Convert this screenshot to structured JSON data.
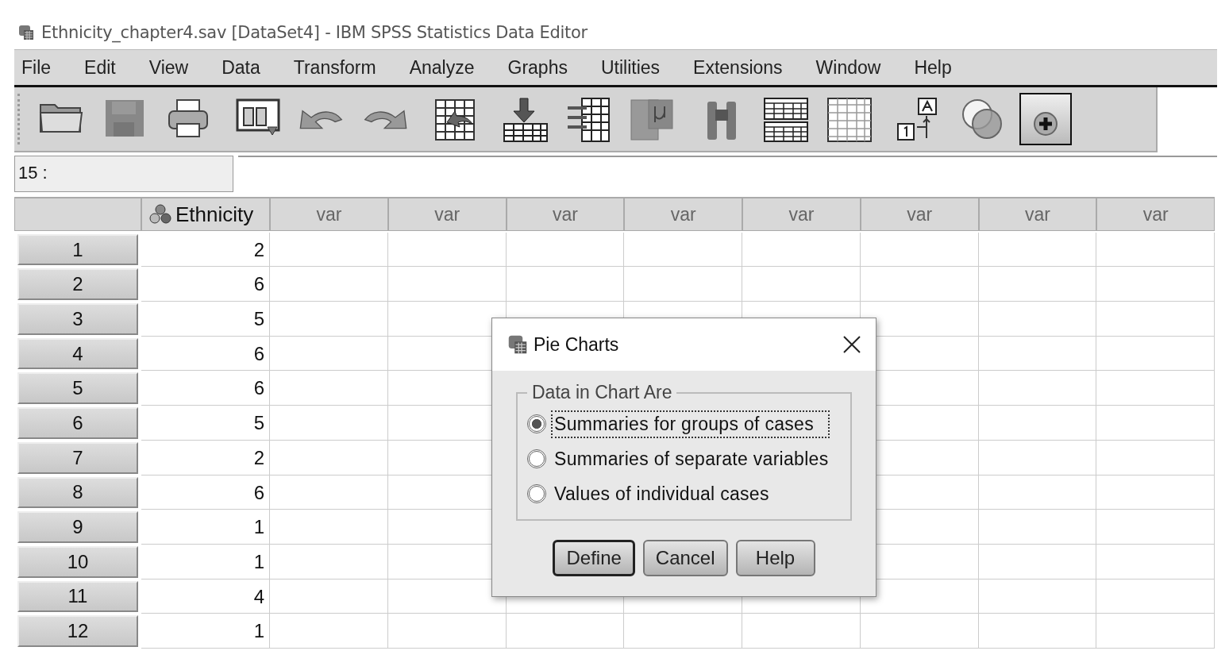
{
  "window": {
    "title": "Ethnicity_chapter4.sav [DataSet4] - IBM SPSS Statistics Data Editor"
  },
  "menu": [
    "File",
    "Edit",
    "View",
    "Data",
    "Transform",
    "Analyze",
    "Graphs",
    "Utilities",
    "Extensions",
    "Window",
    "Help"
  ],
  "toolbar": [
    {
      "kind": "open",
      "pressed": false
    },
    {
      "kind": "save",
      "pressed": false
    },
    {
      "kind": "print",
      "pressed": false
    },
    {
      "kind": "dialog",
      "pressed": false
    },
    {
      "kind": "undo",
      "pressed": false
    },
    {
      "kind": "redo",
      "pressed": false
    },
    {
      "kind": "goto",
      "pressed": false
    },
    {
      "kind": "insert",
      "pressed": false
    },
    {
      "kind": "variables",
      "pressed": false
    },
    {
      "kind": "stats",
      "pressed": false
    },
    {
      "kind": "find",
      "pressed": false
    },
    {
      "kind": "split",
      "pressed": false
    },
    {
      "kind": "grid",
      "pressed": false
    },
    {
      "kind": "labels",
      "pressed": false
    },
    {
      "kind": "sets",
      "pressed": false
    },
    {
      "kind": "plus",
      "pressed": true
    }
  ],
  "cell_ref": "15 :",
  "table": {
    "columns": [
      {
        "label": "Ethnicity",
        "kind": "variable"
      },
      {
        "label": "var",
        "kind": "empty"
      },
      {
        "label": "var",
        "kind": "empty"
      },
      {
        "label": "var",
        "kind": "empty"
      },
      {
        "label": "var",
        "kind": "empty"
      },
      {
        "label": "var",
        "kind": "empty"
      },
      {
        "label": "var",
        "kind": "empty"
      },
      {
        "label": "var",
        "kind": "empty"
      },
      {
        "label": "var",
        "kind": "empty"
      }
    ],
    "rows": [
      {
        "number": "1",
        "cells": [
          "2"
        ]
      },
      {
        "number": "2",
        "cells": [
          "6"
        ]
      },
      {
        "number": "3",
        "cells": [
          "5"
        ]
      },
      {
        "number": "4",
        "cells": [
          "6"
        ]
      },
      {
        "number": "5",
        "cells": [
          "6"
        ]
      },
      {
        "number": "6",
        "cells": [
          "5"
        ]
      },
      {
        "number": "7",
        "cells": [
          "2"
        ]
      },
      {
        "number": "8",
        "cells": [
          "6"
        ]
      },
      {
        "number": "9",
        "cells": [
          "1"
        ]
      },
      {
        "number": "10",
        "cells": [
          "1"
        ]
      },
      {
        "number": "11",
        "cells": [
          "4"
        ]
      },
      {
        "number": "12",
        "cells": [
          "1"
        ]
      }
    ]
  },
  "dialog": {
    "title": "Pie Charts",
    "group": "Data in Chart Are",
    "options": [
      {
        "label": "Summaries for groups of cases",
        "selected": true,
        "focused": true
      },
      {
        "label": "Summaries of separate variables",
        "selected": false,
        "focused": false
      },
      {
        "label": "Values of individual cases",
        "selected": false,
        "focused": false
      }
    ],
    "buttons": [
      {
        "label": "Define",
        "default": true
      },
      {
        "label": "Cancel",
        "default": false
      },
      {
        "label": "Help",
        "default": false
      }
    ]
  }
}
